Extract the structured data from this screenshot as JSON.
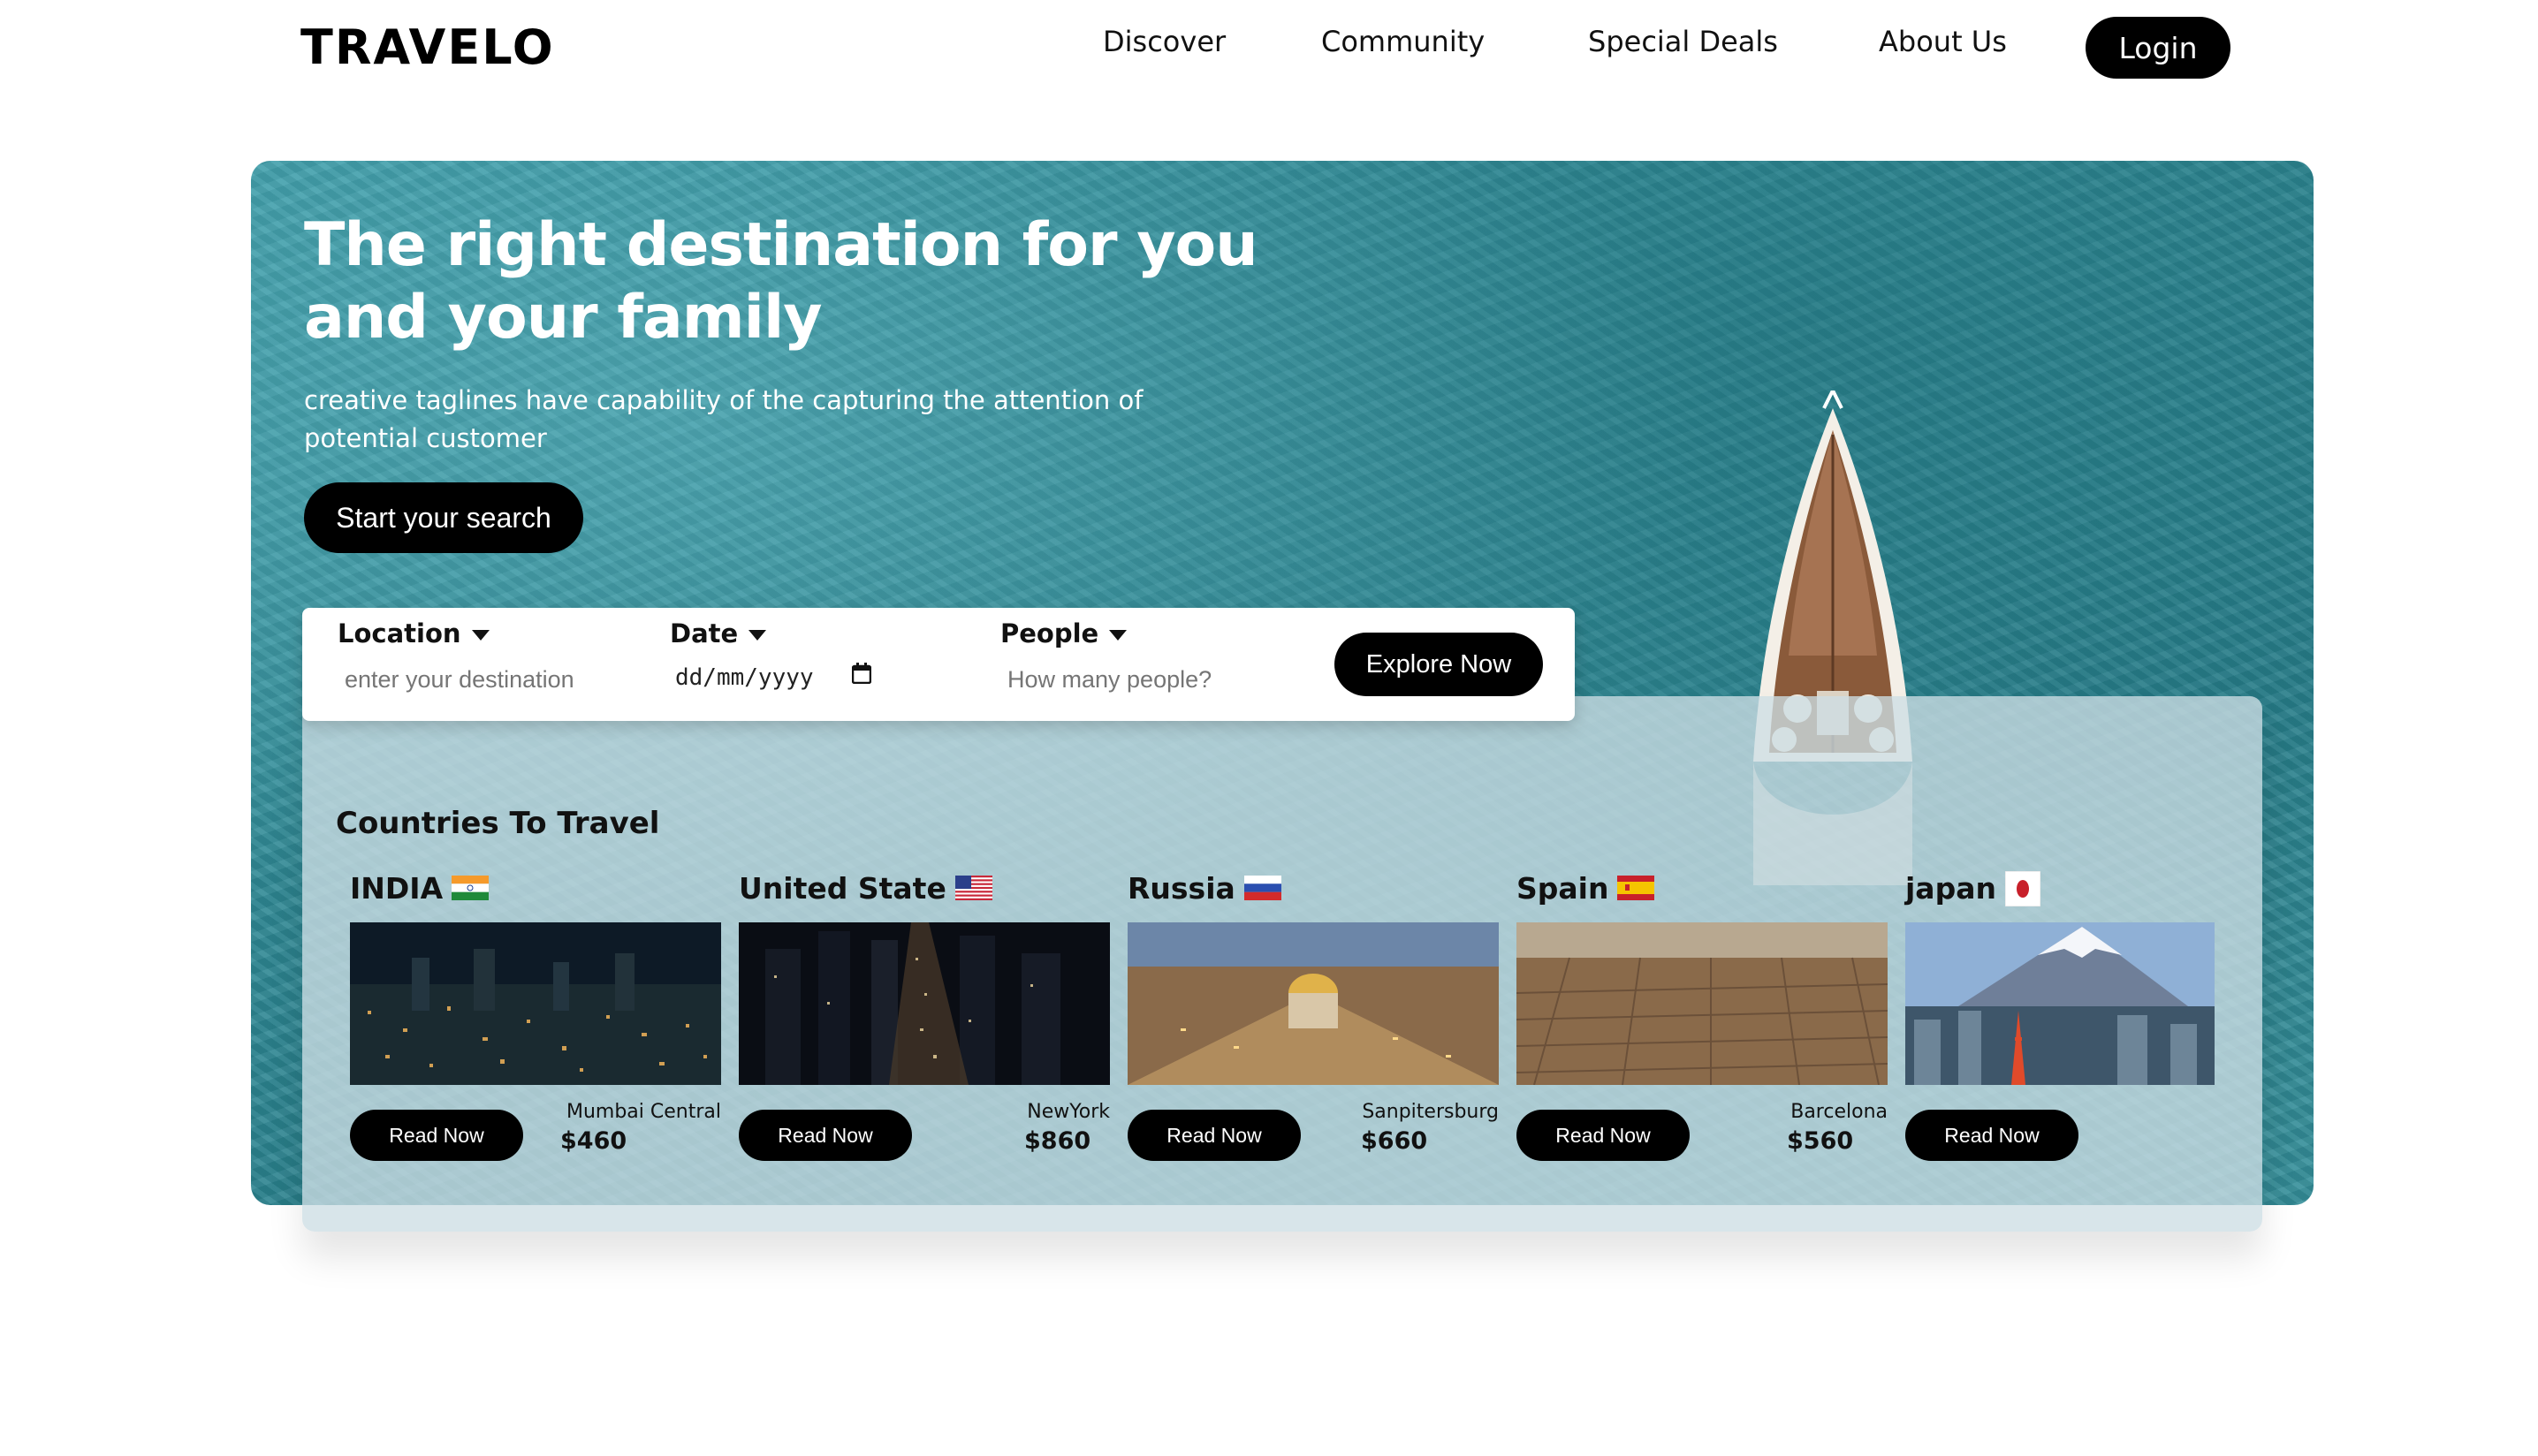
{
  "brand": "TRAVELO",
  "nav": {
    "links": [
      "Discover",
      "Community",
      "Special Deals",
      "About Us"
    ],
    "login": "Login"
  },
  "hero": {
    "title_line1": "The right destination for you",
    "title_line2": "and your family",
    "tagline_line1": "creative taglines have capability of the capturing the attention of",
    "tagline_line2": "potential customer",
    "start_button": "Start your search"
  },
  "search": {
    "location_label": "Location",
    "location_placeholder": "enter your destination",
    "date_label": "Date",
    "date_value": "dd/mm/yyyy",
    "people_label": "People",
    "people_placeholder": "How many people?",
    "explore_button": "Explore Now"
  },
  "countries": {
    "title": "Countries To Travel",
    "read_label": "Read Now",
    "items": [
      {
        "name": "INDIA",
        "city": "Mumbai Central",
        "price": "$460",
        "flag": "india-flag"
      },
      {
        "name": "United State",
        "city": "NewYork",
        "price": "$860",
        "flag": "usa-flag"
      },
      {
        "name": "Russia",
        "city": "Sanpitersburg",
        "price": "$660",
        "flag": "russia-flag"
      },
      {
        "name": "Spain",
        "city": "Barcelona",
        "price": "$560",
        "flag": "spain-flag"
      },
      {
        "name": "japan",
        "city": "",
        "price": "",
        "flag": "japan-flag"
      }
    ]
  },
  "colors": {
    "sea": "#2f8995",
    "button": "#000000",
    "panel": "#cddee4"
  }
}
